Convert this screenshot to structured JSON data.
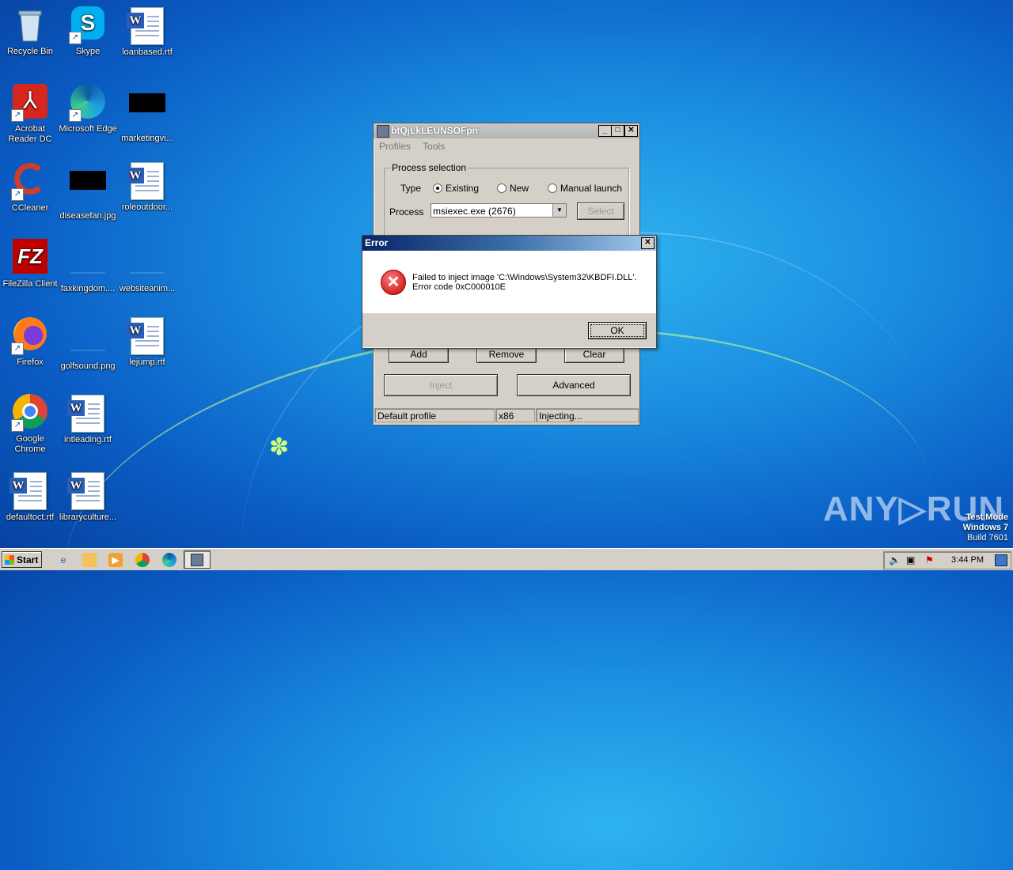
{
  "desktop": {
    "icons": [
      {
        "label": "Recycle Bin",
        "icon": "recycle-bin-icon"
      },
      {
        "label": "Skype",
        "icon": "skype-icon"
      },
      {
        "label": "loanbased.rtf",
        "icon": "word-document-icon"
      },
      {
        "label": "Acrobat Reader DC",
        "icon": "acrobat-icon"
      },
      {
        "label": "Microsoft Edge",
        "icon": "edge-icon"
      },
      {
        "label": "marketingvi...",
        "icon": "video-thumbnail-icon"
      },
      {
        "label": "CCleaner",
        "icon": "ccleaner-icon"
      },
      {
        "label": "diseasefan.jpg",
        "icon": "image-thumbnail-icon"
      },
      {
        "label": "roleoutdoor...",
        "icon": "word-document-icon"
      },
      {
        "label": "FileZilla Client",
        "icon": "filezilla-icon"
      },
      {
        "label": "faxkingdom....",
        "icon": "file-icon"
      },
      {
        "label": "websiteanim...",
        "icon": "file-icon"
      },
      {
        "label": "Firefox",
        "icon": "firefox-icon"
      },
      {
        "label": "golfsound.png",
        "icon": "image-icon"
      },
      {
        "label": "lejump.rtf",
        "icon": "word-document-icon"
      },
      {
        "label": "Google Chrome",
        "icon": "chrome-icon"
      },
      {
        "label": "intleading.rtf",
        "icon": "word-document-icon"
      },
      {
        "label": "defaultoct.rtf",
        "icon": "word-document-icon"
      },
      {
        "label": "libraryculture...",
        "icon": "word-document-icon"
      }
    ]
  },
  "injector": {
    "title": "btQjLkLEUNSOFpn",
    "menu": {
      "profiles": "Profiles",
      "tools": "Tools"
    },
    "process_selection": {
      "title": "Process selection",
      "type_label": "Type",
      "options": [
        "Existing",
        "New",
        "Manual launch"
      ],
      "selected": "Existing",
      "process_label": "Process",
      "process_value": "msiexec.exe (2676)",
      "select_button": "Select"
    },
    "buttons": {
      "add": "Add",
      "remove": "Remove",
      "clear": "Clear",
      "inject": "Inject",
      "advanced": "Advanced"
    },
    "status": {
      "profile": "Default profile",
      "arch": "x86",
      "state": "Injecting..."
    }
  },
  "error_dialog": {
    "title": "Error",
    "message_line1": "Failed to inject image 'C:\\Windows\\System32\\KBDFI.DLL'.",
    "message_line2": "Error code 0xC000010E",
    "ok": "OK"
  },
  "watermark": {
    "brand": "ANY▷RUN",
    "mode": "Test Mode",
    "os": "Windows 7",
    "build": "Build 7601"
  },
  "taskbar": {
    "start": "Start",
    "clock": "3:44 PM"
  }
}
